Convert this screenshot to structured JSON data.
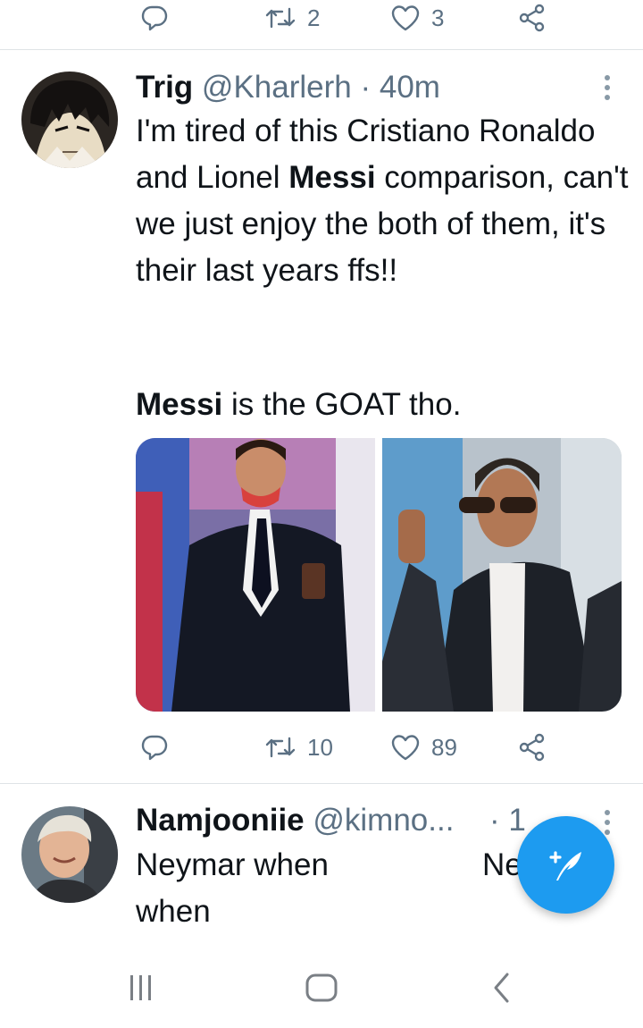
{
  "top_actions": {
    "reply_icon": "reply-icon",
    "retweet_count": "2",
    "like_count": "3",
    "share_icon": "share-icon"
  },
  "tweet1": {
    "display_name": "Trig",
    "handle_time": "@Kharlerh · 40m",
    "text_part1": "I'm tired of this Cristiano Ronaldo and Lionel ",
    "text_bold1": "Messi",
    "text_part2": " comparison, can't we just enjoy the both of them, it's their last years ffs!!",
    "text_bold2": "Messi",
    "text_part3": " is the GOAT tho.",
    "retweet_count": "10",
    "like_count": "89",
    "accent_color": "#1d9bf0",
    "icon_color": "#5b7083"
  },
  "tweet2": {
    "display_name": "Namjooniie",
    "handle": "@kimno...",
    "time_partial": "· 1",
    "text_line1": "Neymar when",
    "text_right": "Ne",
    "text_line2": "when"
  },
  "nav": {
    "recent_apps_icon": "recent-apps-icon",
    "home_icon": "home-icon",
    "back_icon": "back-icon"
  },
  "fab": {
    "icon": "compose-tweet-icon",
    "color": "#1d9bf0"
  }
}
